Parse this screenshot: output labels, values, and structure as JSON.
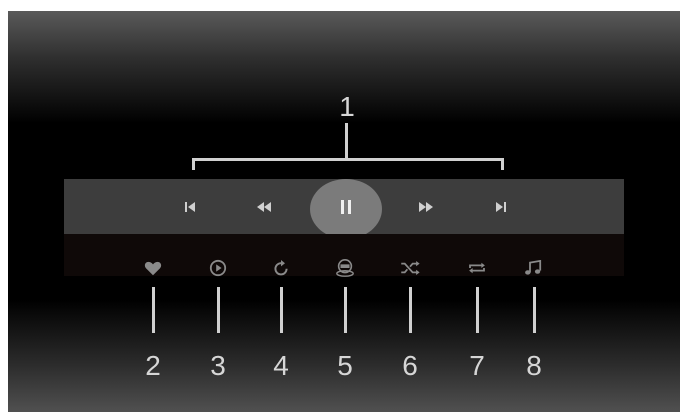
{
  "callouts": {
    "top": "1",
    "options": [
      "2",
      "3",
      "4",
      "5",
      "6",
      "7",
      "8"
    ]
  },
  "transport": {
    "icons": [
      "skip-previous-icon",
      "rewind-icon",
      "pause-icon",
      "fast-forward-icon",
      "skip-next-icon"
    ]
  },
  "options": {
    "icons": [
      "heart-icon",
      "play-circle-icon",
      "replay-icon",
      "view-360-icon",
      "shuffle-icon",
      "repeat-icon",
      "music-notes-icon"
    ]
  },
  "colors": {
    "icon": "#cfcfcf",
    "icon_dim": "#8a8a8a",
    "control_bar": "#3d3d3d",
    "highlight": "#7b7b7b"
  }
}
